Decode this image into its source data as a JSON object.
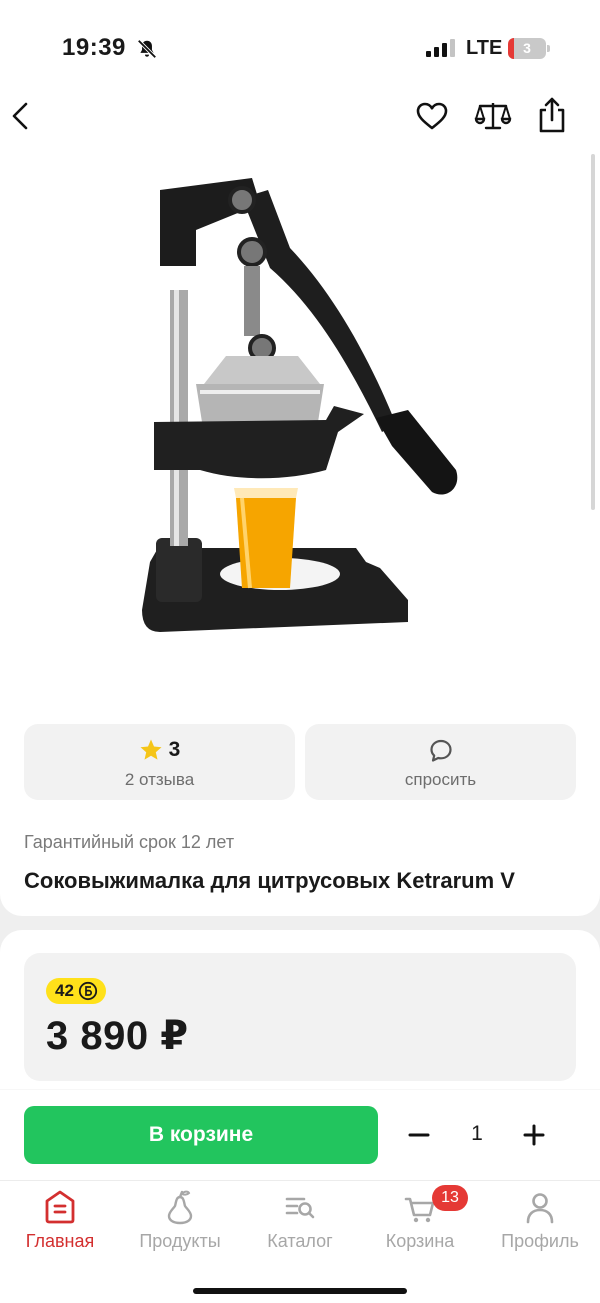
{
  "status_bar": {
    "time": "19:39",
    "network": "LTE",
    "battery_level": "3",
    "icons": [
      "bell-slash-icon",
      "signal-icon",
      "battery-icon"
    ]
  },
  "header": {
    "icons": [
      "back-icon",
      "heart-icon",
      "compare-scales-icon",
      "share-icon"
    ]
  },
  "product": {
    "image": "citrus-juicer-image",
    "rating": "3",
    "reviews_label": "2 отзыва",
    "ask_label": "спросить",
    "warranty": "Гарантийный срок 12 лет",
    "title": "Соковыжималка для цитрусовых Ketrarum V"
  },
  "pricing": {
    "bonus": "42",
    "price": "3 890 ₽"
  },
  "cart_action": {
    "button_label": "В корзине",
    "quantity": "1"
  },
  "tab_bar": {
    "tabs": [
      {
        "label": "Главная",
        "icon": "home-icon",
        "active": true
      },
      {
        "label": "Продукты",
        "icon": "pear-icon",
        "active": false
      },
      {
        "label": "Каталог",
        "icon": "catalog-search-icon",
        "active": false
      },
      {
        "label": "Корзина",
        "icon": "cart-icon",
        "active": false
      },
      {
        "label": "Профиль",
        "icon": "profile-icon",
        "active": false
      }
    ],
    "cart_badge": "13"
  },
  "colors": {
    "accent_green": "#22c55e",
    "active_red": "#d32f2f",
    "badge_red": "#e53935",
    "bonus_yellow": "#ffe11a",
    "star_yellow": "#f5c518"
  }
}
